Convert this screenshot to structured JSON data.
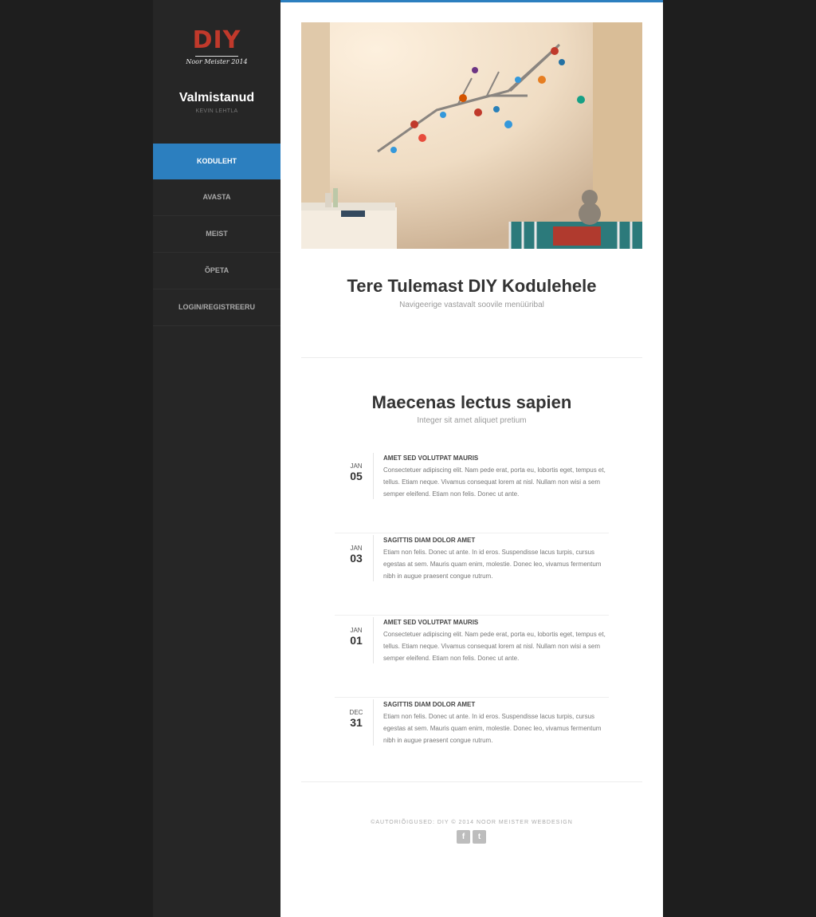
{
  "logo": {
    "text": "DIY",
    "subtitle": "Noor Meister 2014"
  },
  "author": {
    "title": "Valmistanud",
    "name": "KEVIN LEHTLA"
  },
  "nav": [
    {
      "label": "KODULEHT",
      "active": true
    },
    {
      "label": "AVASTA"
    },
    {
      "label": "MEIST"
    },
    {
      "label": "ÕPETA"
    },
    {
      "label": "LOGIN/REGISTREERU"
    }
  ],
  "colors": {
    "accent": "#2c7fbf",
    "sidebar": "#262626",
    "background": "#1e1e1e",
    "logo": "#c0392b"
  },
  "welcome": {
    "title": "Tere Tulemast DIY Kodulehele",
    "subtitle": "Navigeerige vastavalt soovile menüüribal"
  },
  "section": {
    "title": "Maecenas lectus sapien",
    "subtitle": "Integer sit amet aliquet pretium"
  },
  "posts": [
    {
      "month": "JAN",
      "day": "05",
      "title": "AMET SED VOLUTPAT MAURIS",
      "text": "Consectetuer adipiscing elit. Nam pede erat, porta eu, lobortis eget, tempus et, tellus. Etiam neque. Vivamus consequat lorem at nisl. Nullam non wisi a sem semper eleifend. Etiam non felis. Donec ut ante."
    },
    {
      "month": "JAN",
      "day": "03",
      "title": "SAGITTIS DIAM DOLOR AMET",
      "text": "Etiam non felis. Donec ut ante. In id eros. Suspendisse lacus turpis, cursus egestas at sem. Mauris quam enim, molestie. Donec leo, vivamus fermentum nibh in augue praesent congue rutrum."
    },
    {
      "month": "JAN",
      "day": "01",
      "title": "AMET SED VOLUTPAT MAURIS",
      "text": "Consectetuer adipiscing elit. Nam pede erat, porta eu, lobortis eget, tempus et, tellus. Etiam neque. Vivamus consequat lorem at nisl. Nullam non wisi a sem semper eleifend. Etiam non felis. Donec ut ante."
    },
    {
      "month": "DEC",
      "day": "31",
      "title": "SAGITTIS DIAM DOLOR AMET",
      "text": "Etiam non felis. Donec ut ante. In id eros. Suspendisse lacus turpis, cursus egestas at sem. Mauris quam enim, molestie. Donec leo, vivamus fermentum nibh in augue praesent congue rutrum."
    }
  ],
  "footer": {
    "text": "©Autoriõigused: DIY © 2014 Noor Meister Webdesign",
    "facebook_icon": "f",
    "twitter_icon": "t"
  }
}
